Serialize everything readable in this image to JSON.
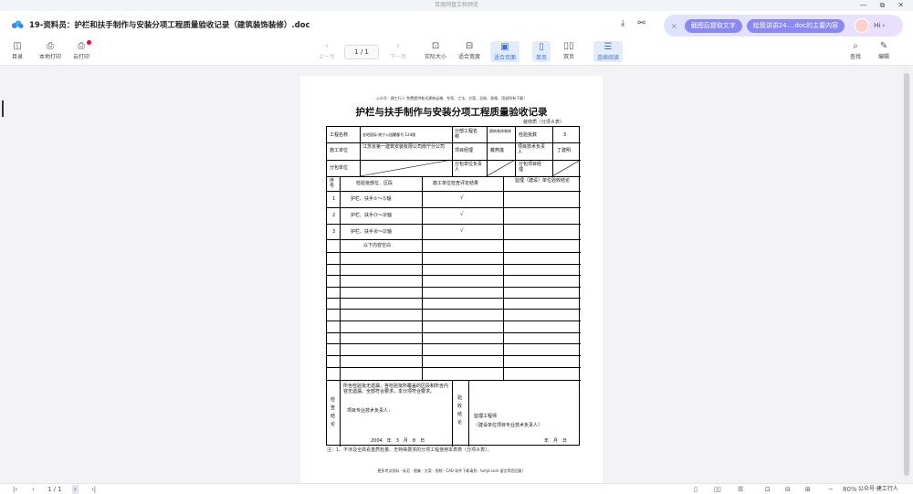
{
  "window": {
    "title": "百度网盘文档预览",
    "controls": [
      "—",
      "⧉",
      "✕"
    ]
  },
  "file": {
    "name": "19-资料员：护栏和扶手制作与安装分项工程质量验收记录（建筑装饰装修）.doc"
  },
  "ai_panel": {
    "close": "×",
    "btn1": "截图后提取文字",
    "btn2": "给我讲讲24....doc的主要内容",
    "hi": "Hi ›"
  },
  "toolbar": {
    "contents": "目录",
    "local_print": "本地打印",
    "cloud_print": "云打印",
    "prev": "上一页",
    "page": "1 / 1",
    "next": "下一页",
    "actual": "实际大小",
    "fit_width": "适合宽度",
    "fit_page": "适合页面",
    "single": "单页",
    "double": "双页",
    "continuous": "连续阅读",
    "search": "查找",
    "edit": "编辑"
  },
  "document": {
    "header_note": "公众号：建工行人 免费提供各式建筑云端、专项、工法、方案、总结、表格、用说所有下载！",
    "title": "护栏与扶手制作与安装分项工程质量验收记录",
    "code": "装修质（分项Ａ表）",
    "row1": {
      "l1": "工程名称",
      "v1": "金地国际·南宁公园麓都号 124楼",
      "l2": "分部工程名　称",
      "v2": "建筑装饰装修",
      "l3": "检验批数",
      "v3": "3"
    },
    "row2": {
      "l1": "施工单位",
      "v1": "江苏省第一建筑安装有限公司南宁分公司",
      "l2": "项目经理",
      "v2": "戴燕莲",
      "l3": "项目技术负责　人",
      "v3": "丁建明"
    },
    "row3": {
      "l1": "分包单位",
      "l2": "分包单位负责人",
      "l3": "分包项目经　理"
    },
    "headers": {
      "no": "序号",
      "part": "检验批部位、区段",
      "check": "施工单位检查评定结果",
      "supervision": "监理（建设）单位验收结论"
    },
    "rows": [
      {
        "no": "1",
        "part": "护栏、扶手①～⑬轴",
        "check": "√"
      },
      {
        "no": "2",
        "part": "护栏、扶手⑬～⑳轴",
        "check": "√"
      },
      {
        "no": "3",
        "part": "护栏、扶手⑳～㉒轴",
        "check": "√"
      },
      {
        "no": "",
        "part": "以下内容空白",
        "check": ""
      }
    ],
    "check_label": "检查结论",
    "check_text": "所含检验批无遗漏，各检验批所覆盖的区段和所含内容无遗漏，全部符合要求，本分项符合要求。",
    "check_sign": "项目专业技术负责人：",
    "check_date": "2004　年　3　月　8　日",
    "accept_label": "验收结论",
    "accept_sign": "监理工程师",
    "accept_sub": "（建设单位项目专业技术负责人）",
    "accept_date": "年　月　日",
    "footnote": "注：1、不涉及全高看重质检量、无特殊要求的分项工程使用本表表（分项Ａ表）。",
    "page_footer": "更多考试资料 · 标范 · 图集 · 方案 · 视频 · CAD 软件下载请到：tuhjd.com  留言等您回复！"
  },
  "statusbar": {
    "page": "1 / 1",
    "zoom": "80%",
    "watermark": "公众号·建工行人"
  }
}
